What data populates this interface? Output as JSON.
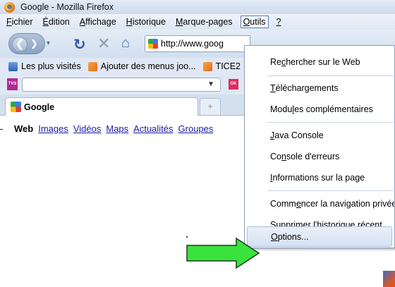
{
  "window": {
    "title": "Google - Mozilla Firefox"
  },
  "menubar": [
    {
      "pre": "",
      "key": "F",
      "post": "ichier"
    },
    {
      "pre": "",
      "key": "É",
      "post": "dition"
    },
    {
      "pre": "",
      "key": "A",
      "post": "ffichage"
    },
    {
      "pre": "",
      "key": "H",
      "post": "istorique"
    },
    {
      "pre": "",
      "key": "M",
      "post": "arque-pages"
    },
    {
      "pre": "",
      "key": "O",
      "post": "utils"
    },
    {
      "pre": "",
      "key": "?",
      "post": ""
    }
  ],
  "nav": {
    "url": "http://www.goog"
  },
  "bookmarks": {
    "most_visited": "Les plus visités",
    "add_menus": "Ajouter des menus joo...",
    "tice": "TICE2"
  },
  "toolbar2": {
    "tvs": "TVS",
    "ok": "OK"
  },
  "tab": {
    "title": "Google",
    "new_tab": "+"
  },
  "google_links": [
    "Web",
    "Images",
    "Vidéos",
    "Maps",
    "Actualités",
    "Groupes"
  ],
  "dropdown": {
    "search_web": {
      "pre": "Re",
      "key": "c",
      "post": "hercher sur le Web"
    },
    "downloads": {
      "pre": "",
      "key": "T",
      "post": "éléchargements"
    },
    "addons": {
      "pre": "Modu",
      "key": "l",
      "post": "es complémentaires"
    },
    "java": {
      "pre": "",
      "key": "J",
      "post": "ava Console"
    },
    "error_console": {
      "pre": "Co",
      "key": "n",
      "post": "sole d'erreurs"
    },
    "page_info": {
      "pre": "",
      "key": "I",
      "post": "nformations sur la page"
    },
    "private": {
      "pre": "Comm",
      "key": "e",
      "post": "ncer la navigation privée"
    },
    "clear_history": {
      "pre": "Supprimer l'",
      "key": "h",
      "post": "istorique récent..."
    },
    "options": {
      "pre": "",
      "key": "O",
      "post": "ptions..."
    }
  },
  "colors": {
    "arrow_fill": "#39e23c",
    "arrow_stroke": "#1e3a1e",
    "highlight": "#d5e2f3"
  }
}
